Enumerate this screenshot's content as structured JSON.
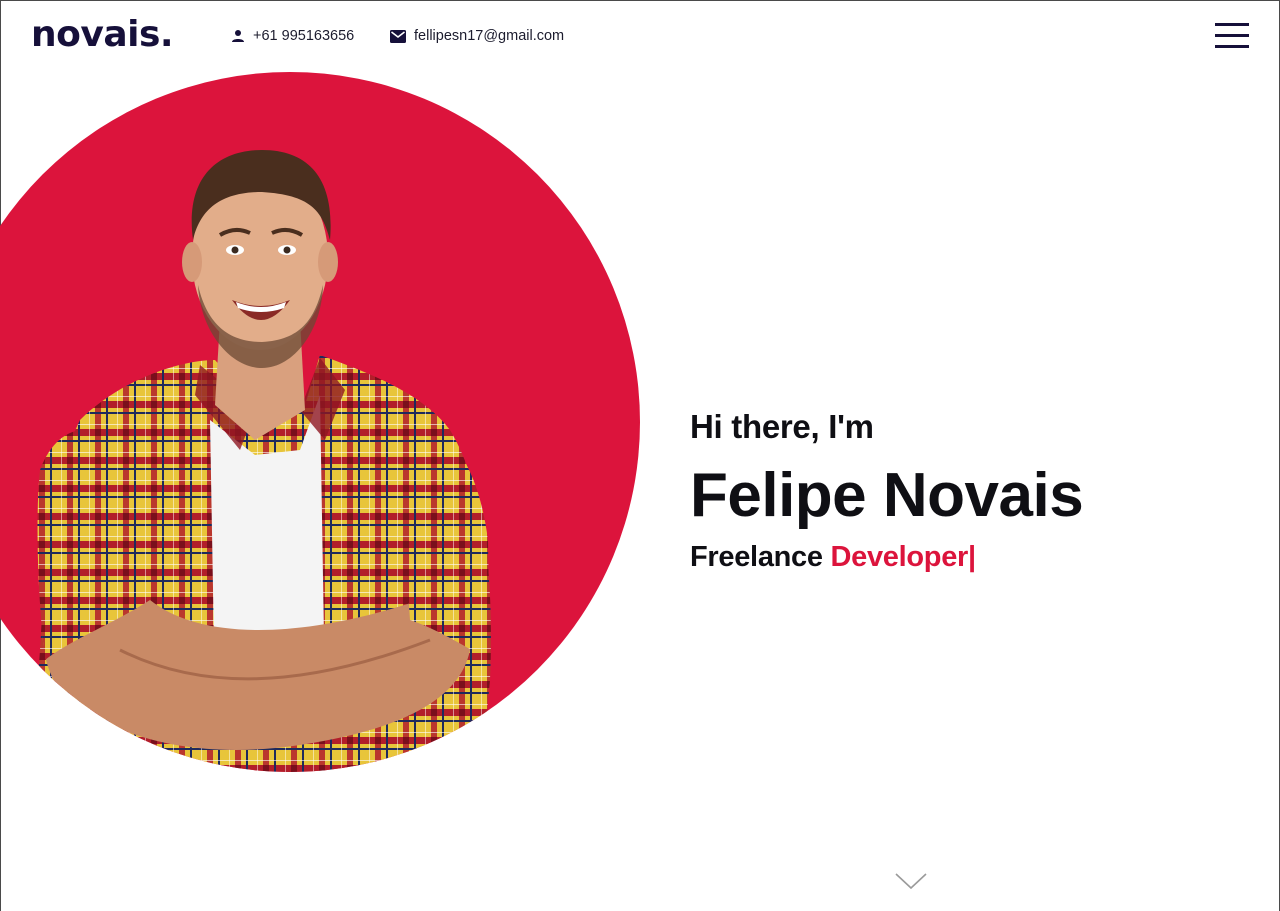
{
  "brand": {
    "logo": "novais."
  },
  "contact": {
    "phone": "+61 995163656",
    "email": "fellipesn17@gmail.com"
  },
  "hero": {
    "greeting": "Hi there, I'm",
    "name": "Felipe Novais",
    "role_prefix": "Freelance",
    "role_highlight": "Developer|"
  },
  "colors": {
    "accent": "#dc143c",
    "brand_dark": "#16103a",
    "background": "#ffffff"
  },
  "icons": {
    "phone": "person-icon",
    "email": "mail-icon",
    "menu": "hamburger-menu-icon",
    "scroll": "chevron-down-icon"
  }
}
